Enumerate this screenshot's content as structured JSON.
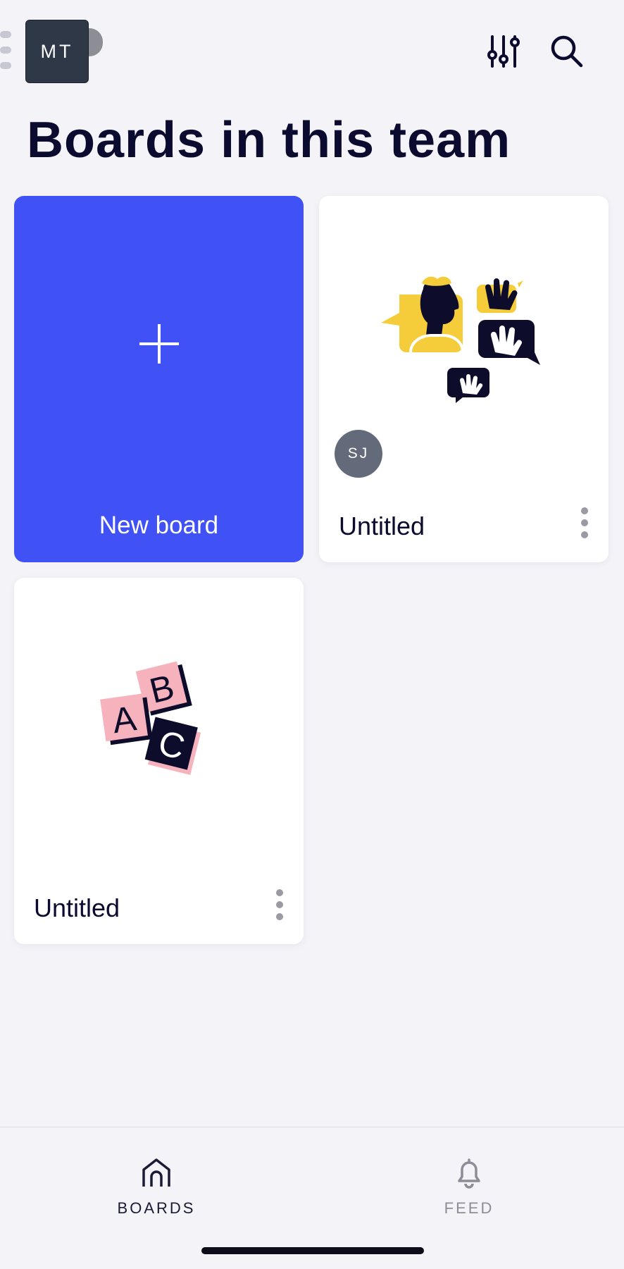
{
  "header": {
    "team_initials": "MT",
    "filter_icon": "sliders-icon",
    "search_icon": "search-icon"
  },
  "page": {
    "title": "Boards in this team"
  },
  "new_board": {
    "label": "New board",
    "icon": "plus-icon",
    "color": "#4052f5"
  },
  "boards": [
    {
      "title": "Untitled",
      "owner_initials": "SJ",
      "illustration": "waving-chat-illustration"
    },
    {
      "title": "Untitled",
      "illustration": "abc-blocks-illustration"
    }
  ],
  "bottom_nav": {
    "items": [
      {
        "label": "BOARDS",
        "icon": "home-icon",
        "active": true
      },
      {
        "label": "FEED",
        "icon": "bell-icon",
        "active": false
      }
    ]
  }
}
